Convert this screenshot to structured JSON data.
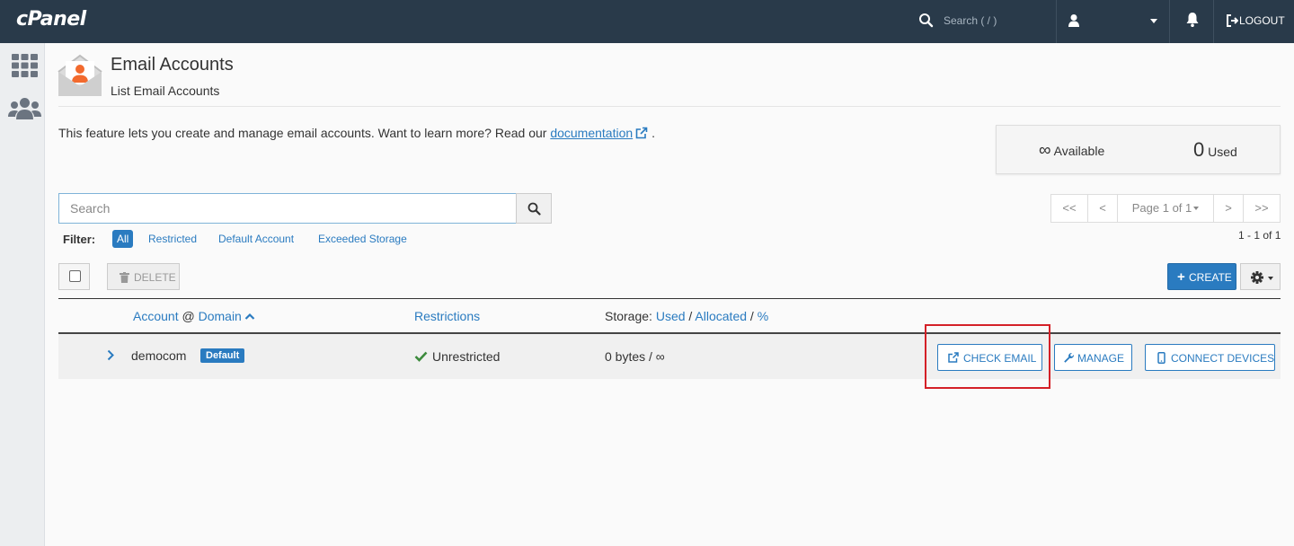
{
  "topbar": {
    "brand": "cPanel",
    "search_placeholder": "Search ( / )",
    "logout_label": "LOGOUT"
  },
  "header": {
    "title": "Email Accounts",
    "subtitle": "List Email Accounts"
  },
  "intro": {
    "text": "This feature lets you create and manage email accounts. Want to learn more? Read our ",
    "link": "documentation",
    "tail": "."
  },
  "stats": {
    "available_value": "∞",
    "available_label": "Available",
    "used_value": "0",
    "used_label": "Used"
  },
  "search": {
    "placeholder": "Search"
  },
  "filter": {
    "label": "Filter:",
    "options": [
      "All",
      "Restricted",
      "Default Account",
      "Exceeded Storage"
    ],
    "active": "All"
  },
  "pagination": {
    "first": "<<",
    "prev": "<",
    "page": "Page 1 of 1",
    "next": ">",
    "last": ">>",
    "count": "1 - 1 of 1"
  },
  "actions": {
    "delete_label": "DELETE",
    "create_label": "CREATE"
  },
  "table": {
    "headers": {
      "account": "Account",
      "at": "@",
      "domain": "Domain",
      "restrictions": "Restrictions",
      "storage_prefix": "Storage:",
      "used": "Used",
      "sep1": "/",
      "allocated": "Allocated",
      "sep2": "/",
      "percent": "%"
    },
    "rows": [
      {
        "account": "democom",
        "badge": "Default",
        "restriction": "Unrestricted",
        "storage": "0 bytes / ∞",
        "buttons": {
          "check_email": "CHECK EMAIL",
          "manage": "MANAGE",
          "connect_devices": "CONNECT DEVICES"
        }
      }
    ]
  },
  "colors": {
    "topbar": "#293a4a",
    "accent": "#2a7bc0",
    "highlight": "#d42027"
  }
}
